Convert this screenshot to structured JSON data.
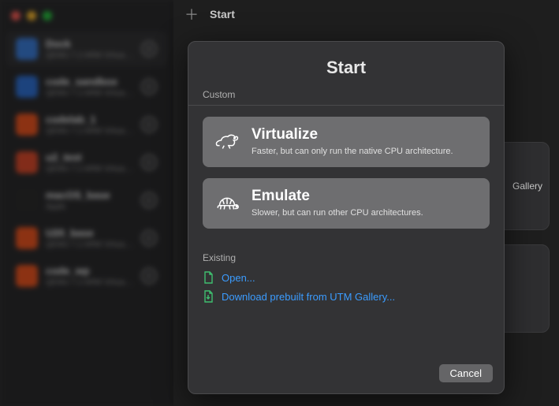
{
  "toolbar": {
    "title": "Start"
  },
  "sidebar": {
    "items": [
      {
        "name": "Dock",
        "subtitle": "QEMU 7.2 ARM Virtual M…",
        "icon_color": "#3b7bd6"
      },
      {
        "name": "code_sandbox",
        "subtitle": "QEMU 7.2 ARM Virtual M…",
        "icon_color": "#2e6fd1"
      },
      {
        "name": "codelab_1",
        "subtitle": "QEMU 7.2 ARM Virtual M…",
        "icon_color": "#e95420"
      },
      {
        "name": "u2_test",
        "subtitle": "QEMU 7.2 ARM Virtual M…",
        "icon_color": "#d84a2b"
      },
      {
        "name": "macOS_base",
        "subtitle": "Apple",
        "icon_color": "#2b2b2b"
      },
      {
        "name": "U20_base",
        "subtitle": "QEMU 7.2 ARM Virtual M…",
        "icon_color": "#e95420"
      },
      {
        "name": "code_wp",
        "subtitle": "QEMU 7.2 ARM Virtual M…",
        "icon_color": "#e95420"
      }
    ]
  },
  "background_cards": [
    {
      "label": "Gallery"
    },
    {
      "label": ""
    }
  ],
  "modal": {
    "title": "Start",
    "custom_label": "Custom",
    "options": [
      {
        "title": "Virtualize",
        "desc": "Faster, but can only run the native CPU architecture."
      },
      {
        "title": "Emulate",
        "desc": "Slower, but can run other CPU architectures."
      }
    ],
    "existing_label": "Existing",
    "links": [
      {
        "label": "Open..."
      },
      {
        "label": "Download prebuilt from UTM Gallery..."
      }
    ],
    "cancel_label": "Cancel"
  }
}
